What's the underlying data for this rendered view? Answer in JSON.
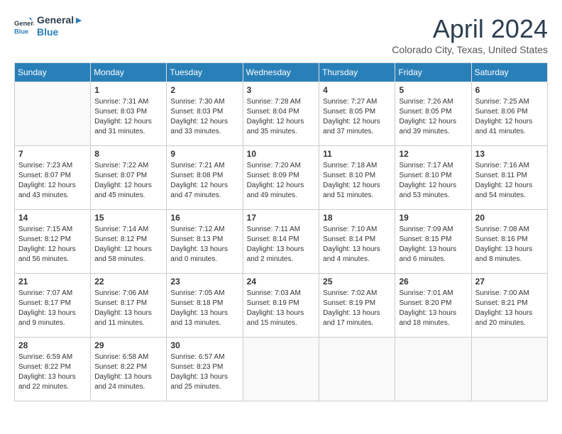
{
  "header": {
    "logo_line1": "General",
    "logo_line2": "Blue",
    "month_year": "April 2024",
    "location": "Colorado City, Texas, United States"
  },
  "weekdays": [
    "Sunday",
    "Monday",
    "Tuesday",
    "Wednesday",
    "Thursday",
    "Friday",
    "Saturday"
  ],
  "weeks": [
    [
      {
        "day": "",
        "info": ""
      },
      {
        "day": "1",
        "info": "Sunrise: 7:31 AM\nSunset: 8:03 PM\nDaylight: 12 hours\nand 31 minutes."
      },
      {
        "day": "2",
        "info": "Sunrise: 7:30 AM\nSunset: 8:03 PM\nDaylight: 12 hours\nand 33 minutes."
      },
      {
        "day": "3",
        "info": "Sunrise: 7:28 AM\nSunset: 8:04 PM\nDaylight: 12 hours\nand 35 minutes."
      },
      {
        "day": "4",
        "info": "Sunrise: 7:27 AM\nSunset: 8:05 PM\nDaylight: 12 hours\nand 37 minutes."
      },
      {
        "day": "5",
        "info": "Sunrise: 7:26 AM\nSunset: 8:05 PM\nDaylight: 12 hours\nand 39 minutes."
      },
      {
        "day": "6",
        "info": "Sunrise: 7:25 AM\nSunset: 8:06 PM\nDaylight: 12 hours\nand 41 minutes."
      }
    ],
    [
      {
        "day": "7",
        "info": "Sunrise: 7:23 AM\nSunset: 8:07 PM\nDaylight: 12 hours\nand 43 minutes."
      },
      {
        "day": "8",
        "info": "Sunrise: 7:22 AM\nSunset: 8:07 PM\nDaylight: 12 hours\nand 45 minutes."
      },
      {
        "day": "9",
        "info": "Sunrise: 7:21 AM\nSunset: 8:08 PM\nDaylight: 12 hours\nand 47 minutes."
      },
      {
        "day": "10",
        "info": "Sunrise: 7:20 AM\nSunset: 8:09 PM\nDaylight: 12 hours\nand 49 minutes."
      },
      {
        "day": "11",
        "info": "Sunrise: 7:18 AM\nSunset: 8:10 PM\nDaylight: 12 hours\nand 51 minutes."
      },
      {
        "day": "12",
        "info": "Sunrise: 7:17 AM\nSunset: 8:10 PM\nDaylight: 12 hours\nand 53 minutes."
      },
      {
        "day": "13",
        "info": "Sunrise: 7:16 AM\nSunset: 8:11 PM\nDaylight: 12 hours\nand 54 minutes."
      }
    ],
    [
      {
        "day": "14",
        "info": "Sunrise: 7:15 AM\nSunset: 8:12 PM\nDaylight: 12 hours\nand 56 minutes."
      },
      {
        "day": "15",
        "info": "Sunrise: 7:14 AM\nSunset: 8:12 PM\nDaylight: 12 hours\nand 58 minutes."
      },
      {
        "day": "16",
        "info": "Sunrise: 7:12 AM\nSunset: 8:13 PM\nDaylight: 13 hours\nand 0 minutes."
      },
      {
        "day": "17",
        "info": "Sunrise: 7:11 AM\nSunset: 8:14 PM\nDaylight: 13 hours\nand 2 minutes."
      },
      {
        "day": "18",
        "info": "Sunrise: 7:10 AM\nSunset: 8:14 PM\nDaylight: 13 hours\nand 4 minutes."
      },
      {
        "day": "19",
        "info": "Sunrise: 7:09 AM\nSunset: 8:15 PM\nDaylight: 13 hours\nand 6 minutes."
      },
      {
        "day": "20",
        "info": "Sunrise: 7:08 AM\nSunset: 8:16 PM\nDaylight: 13 hours\nand 8 minutes."
      }
    ],
    [
      {
        "day": "21",
        "info": "Sunrise: 7:07 AM\nSunset: 8:17 PM\nDaylight: 13 hours\nand 9 minutes."
      },
      {
        "day": "22",
        "info": "Sunrise: 7:06 AM\nSunset: 8:17 PM\nDaylight: 13 hours\nand 11 minutes."
      },
      {
        "day": "23",
        "info": "Sunrise: 7:05 AM\nSunset: 8:18 PM\nDaylight: 13 hours\nand 13 minutes."
      },
      {
        "day": "24",
        "info": "Sunrise: 7:03 AM\nSunset: 8:19 PM\nDaylight: 13 hours\nand 15 minutes."
      },
      {
        "day": "25",
        "info": "Sunrise: 7:02 AM\nSunset: 8:19 PM\nDaylight: 13 hours\nand 17 minutes."
      },
      {
        "day": "26",
        "info": "Sunrise: 7:01 AM\nSunset: 8:20 PM\nDaylight: 13 hours\nand 18 minutes."
      },
      {
        "day": "27",
        "info": "Sunrise: 7:00 AM\nSunset: 8:21 PM\nDaylight: 13 hours\nand 20 minutes."
      }
    ],
    [
      {
        "day": "28",
        "info": "Sunrise: 6:59 AM\nSunset: 8:22 PM\nDaylight: 13 hours\nand 22 minutes."
      },
      {
        "day": "29",
        "info": "Sunrise: 6:58 AM\nSunset: 8:22 PM\nDaylight: 13 hours\nand 24 minutes."
      },
      {
        "day": "30",
        "info": "Sunrise: 6:57 AM\nSunset: 8:23 PM\nDaylight: 13 hours\nand 25 minutes."
      },
      {
        "day": "",
        "info": ""
      },
      {
        "day": "",
        "info": ""
      },
      {
        "day": "",
        "info": ""
      },
      {
        "day": "",
        "info": ""
      }
    ]
  ]
}
